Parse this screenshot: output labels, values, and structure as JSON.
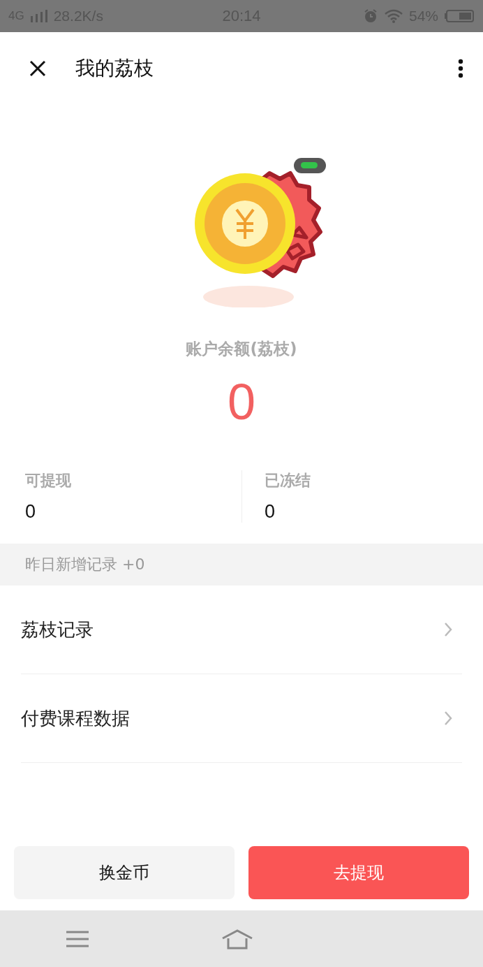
{
  "status_bar": {
    "network": "4G",
    "speed": "28.2K/s",
    "time": "20:14",
    "battery": "54%"
  },
  "header": {
    "title": "我的荔枝"
  },
  "balance": {
    "label": "账户余额(荔枝)",
    "value": "0"
  },
  "stats": [
    {
      "label": "可提现",
      "value": "0"
    },
    {
      "label": "已冻结",
      "value": "0"
    }
  ],
  "notice": "昨日新增记录 +0",
  "menu": [
    "荔枝记录",
    "付费课程数据"
  ],
  "buttons": [
    {
      "label": "换金币",
      "kind": "secondary"
    },
    {
      "label": "去提现",
      "kind": "primary"
    }
  ]
}
